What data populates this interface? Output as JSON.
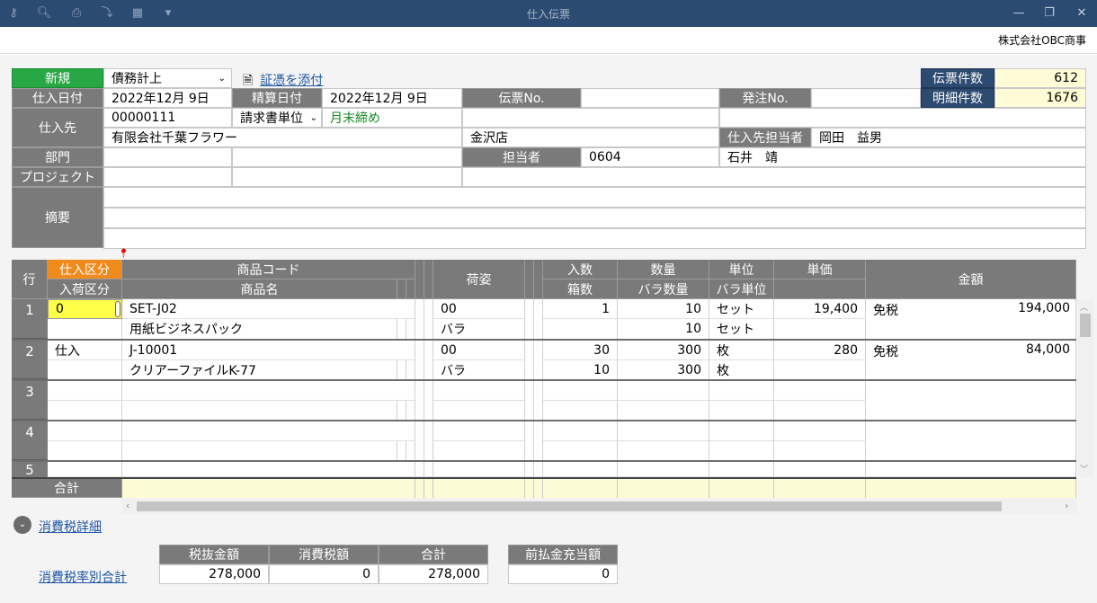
{
  "window": {
    "title": "仕入伝票",
    "company": "株式会社OBC商事"
  },
  "header": {
    "new_label": "新規",
    "type_value": "債務計上",
    "attach_label": "証憑を添付",
    "count_label": "伝票件数",
    "count_value": "612",
    "detail_count_label": "明細件数",
    "detail_count_value": "1676",
    "purchase_date_label": "仕入日付",
    "purchase_date_value": "2022年12月  9日",
    "settle_date_label": "精算日付",
    "settle_date_value": "2022年12月  9日",
    "slip_no_label": "伝票No.",
    "slip_no_value": "",
    "order_no_label": "発注No.",
    "order_no_value": "",
    "supplier_label": "仕入先",
    "supplier_code": "00000111",
    "invoice_unit": "請求書単位",
    "closing": "月末締め",
    "supplier_name": "有限会社千葉フラワー",
    "branch": "金沢店",
    "supplier_rep_label": "仕入先担当者",
    "supplier_rep": "岡田　益男",
    "dept_label": "部門",
    "staff_label": "担当者",
    "staff_code": "0604",
    "staff_name": "石井　靖",
    "project_label": "プロジェクト",
    "memo_label": "摘要"
  },
  "grid": {
    "headers": {
      "row": "行",
      "purchase_type": "仕入区分",
      "arrival_type": "入荷区分",
      "product_code": "商品コード",
      "product_name": "商品名",
      "packing": "荷姿",
      "qty_per": "入数",
      "boxes": "箱数",
      "qty": "数量",
      "loose_qty": "バラ数量",
      "unit": "単位",
      "loose_unit": "バラ単位",
      "price": "単価",
      "amount": "金額"
    },
    "rows": [
      {
        "no": "1",
        "ptype": "0",
        "atype": "",
        "code": "SET-J02",
        "name": "用紙ビジネスパック",
        "pack1": "00",
        "pack2": "バラ",
        "irisu": "1",
        "boxes": "",
        "qty": "10",
        "loose_qty": "10",
        "unit": "セット",
        "loose_unit": "セット",
        "price": "19,400",
        "tax": "免税",
        "amount": "194,000"
      },
      {
        "no": "2",
        "ptype": "仕入",
        "atype": "",
        "code": "J-10001",
        "name": "クリアーファイルK-77",
        "pack1": "00",
        "pack2": "バラ",
        "irisu": "30",
        "boxes": "10",
        "qty": "300",
        "loose_qty": "300",
        "unit": "枚",
        "loose_unit": "枚",
        "price": "280",
        "tax": "免税",
        "amount": "84,000"
      },
      {
        "no": "3"
      },
      {
        "no": "4"
      },
      {
        "no": "5"
      }
    ],
    "total_label": "合計"
  },
  "tax": {
    "detail_label": "消費税詳細",
    "rate_total_label": "消費税率別合計",
    "excl_label": "税抜金額",
    "tax_label": "消費税額",
    "sum_label": "合計",
    "prepay_label": "前払金充当額",
    "excl_value": "278,000",
    "tax_value": "0",
    "sum_value": "278,000",
    "prepay_value": "0"
  }
}
